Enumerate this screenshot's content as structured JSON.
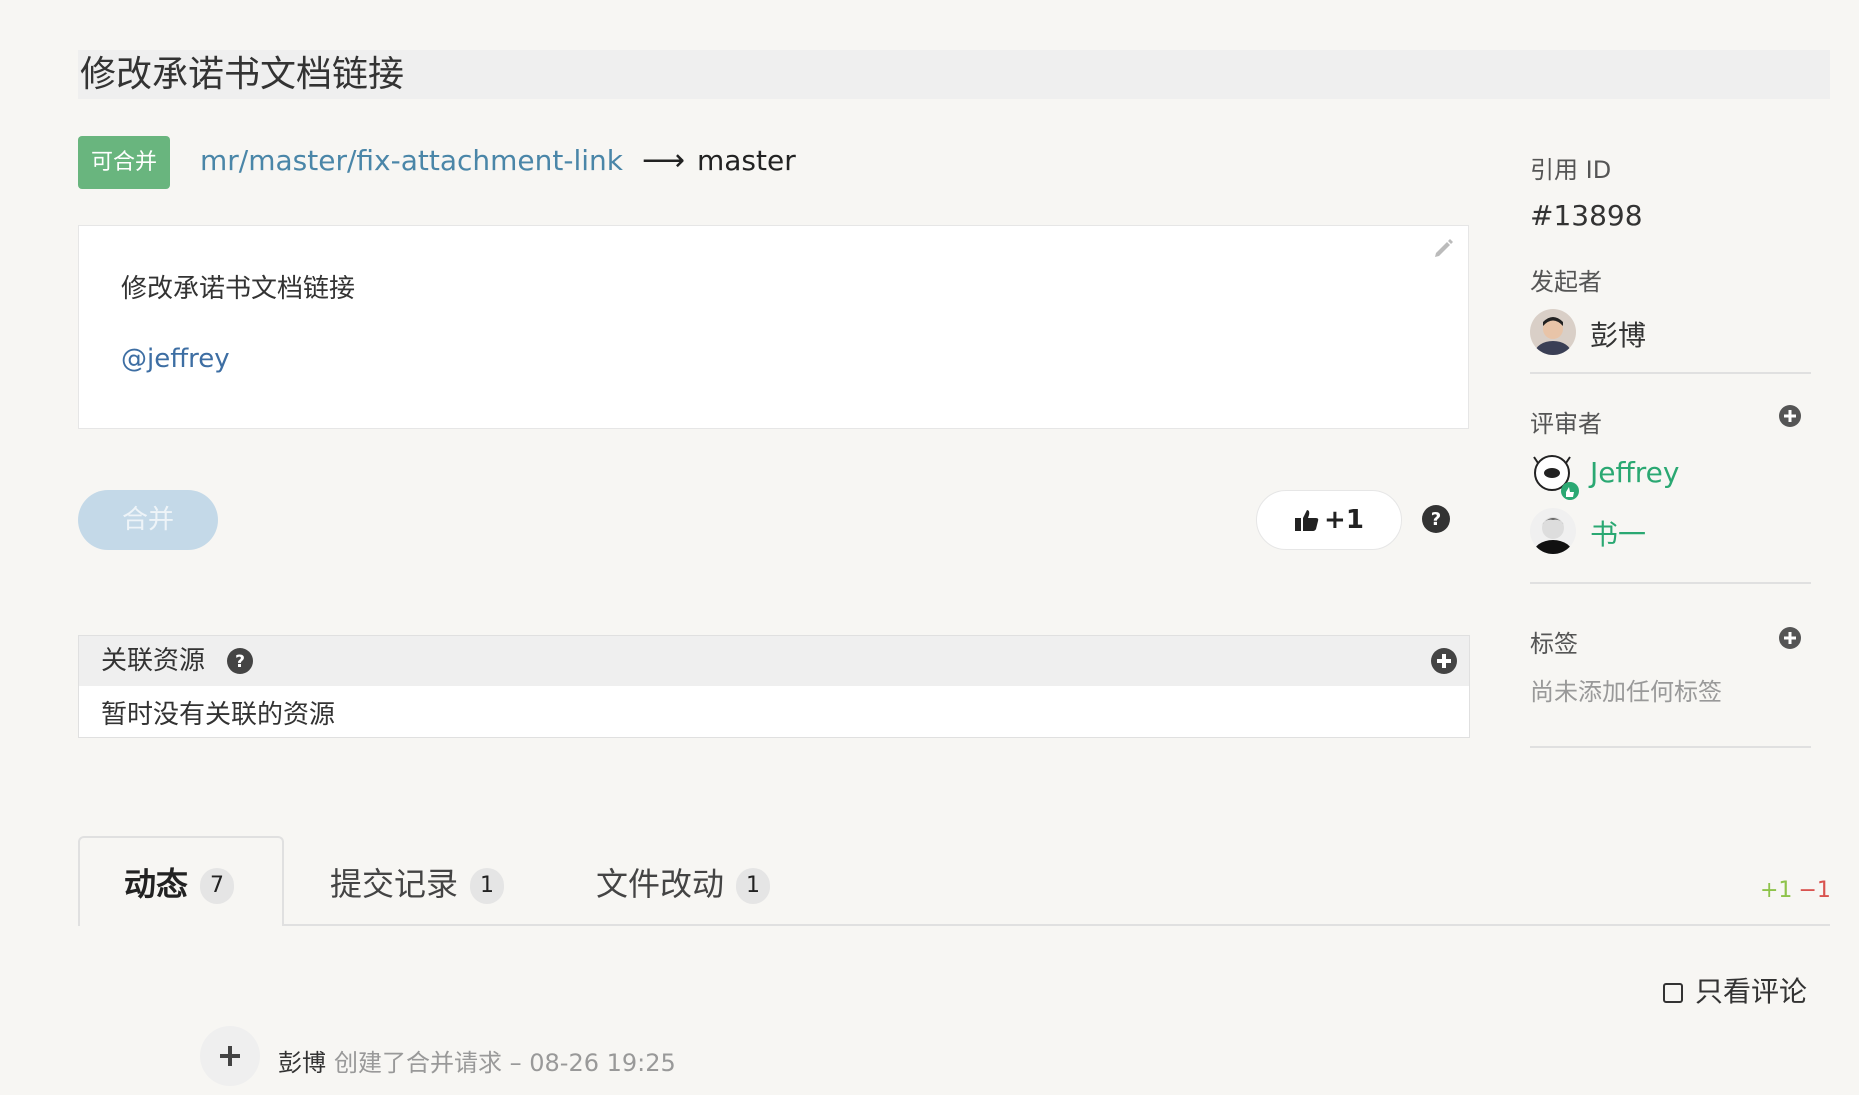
{
  "title": "修改承诺书文档链接",
  "status_badge": "可合并",
  "branches": {
    "source": "mr/master/fix-attachment-link",
    "arrow": "⟶",
    "target": "master"
  },
  "description": {
    "text": "修改承诺书文档链接",
    "mention": "@jeffrey"
  },
  "actions": {
    "merge_label": "合并",
    "like_label": "+1"
  },
  "resources": {
    "title": "关联资源",
    "empty_text": "暂时没有关联的资源"
  },
  "sidebar": {
    "ref_label": "引用 ID",
    "ref_value": "#13898",
    "author_label": "发起者",
    "author_name": "彭博",
    "reviewers_label": "评审者",
    "reviewers": [
      {
        "name": "Jeffrey",
        "approved": true
      },
      {
        "name": "书一",
        "approved": false
      }
    ],
    "tags_label": "标签",
    "tags_empty": "尚未添加任何标签"
  },
  "tabs": [
    {
      "label": "动态",
      "count": "7",
      "active": true
    },
    {
      "label": "提交记录",
      "count": "1",
      "active": false
    },
    {
      "label": "文件改动",
      "count": "1",
      "active": false
    }
  ],
  "diff_stats": {
    "added": "+1",
    "removed": "−1"
  },
  "filters": {
    "only_comments_label": "只看评论"
  },
  "timeline": [
    {
      "user": "彭博",
      "action": "创建了合并请求 – 08-26 19:25",
      "icon": "plus-icon"
    }
  ],
  "colors": {
    "badge_green": "#69b57e",
    "branch_link": "#4a86a8",
    "reviewer_green": "#2aa872",
    "mention_blue": "#3d6ea3",
    "merge_disabled": "#c4d9e8"
  }
}
